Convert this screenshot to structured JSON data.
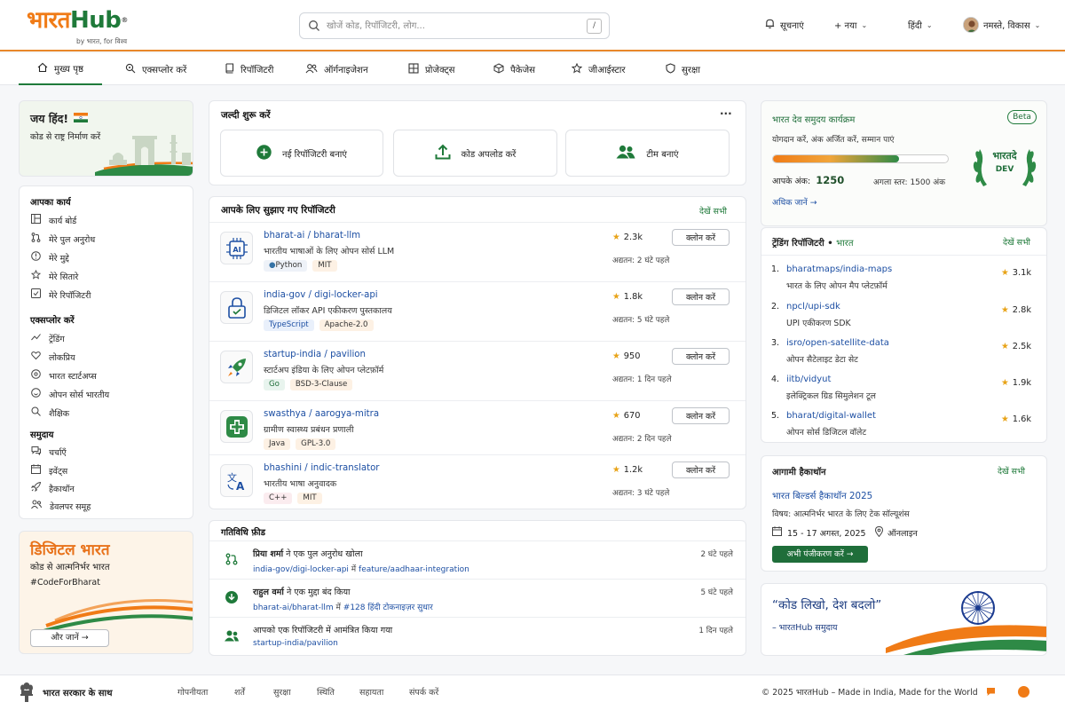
{
  "brand": {
    "name_hi": "भारत",
    "name_en": "Hub",
    "reg": "®",
    "tagline": "by भारत, for विश्व"
  },
  "colors": {
    "saffron": "#f07b16",
    "green": "#1f7a3a",
    "link": "#1d4fa3",
    "chakra_blue": "#1a3a8f"
  },
  "search": {
    "placeholder": "खोजें कोड, रिपॉजिटरी, लोग...",
    "shortcut": "/"
  },
  "header": {
    "notifications": "सूचनाएं",
    "new": "+ नया",
    "language": "हिंदी",
    "greeting": "नमस्ते, विकास"
  },
  "nav": {
    "items": [
      {
        "label": "मुख्य पृष्ठ",
        "icon": "home-icon",
        "active": true
      },
      {
        "label": "एक्सप्लोर करें",
        "icon": "explore-icon"
      },
      {
        "label": "रिपॉजिटरी",
        "icon": "repository-icon"
      },
      {
        "label": "ऑर्गनाइजेशन",
        "icon": "organization-icon"
      },
      {
        "label": "प्रोजेक्ट्स",
        "icon": "projects-icon"
      },
      {
        "label": "पैकेजेस",
        "icon": "package-icon"
      },
      {
        "label": "जीआईस्टार",
        "icon": "star-icon"
      },
      {
        "label": "सुरक्षा",
        "icon": "shield-icon"
      }
    ]
  },
  "welcome": {
    "title": "जय हिंद!",
    "subtitle": "कोड से राष्ट्र निर्माण करें"
  },
  "sidebar": {
    "work_title": "आपका कार्य",
    "work": [
      "कार्य बोर्ड",
      "मेरे पुल अनुरोध",
      "मेरे मुद्दे",
      "मेरे सितारे",
      "मेरे रिपॉजिटरी"
    ],
    "explore_title": "एक्सप्लोर करें",
    "explore": [
      "ट्रेंडिंग",
      "लोकप्रिय",
      "भारत स्टार्टअप्स",
      "ओपन सोर्स भारतीय",
      "शैक्षिक"
    ],
    "community_title": "समुदाय",
    "community": [
      "चर्चाएँ",
      "इवेंट्स",
      "हैकाथॉन",
      "डेवलपर समूह"
    ]
  },
  "digital": {
    "title": "डिजिटल भारत",
    "subtitle": "कोड से आत्मनिर्भर भारत",
    "hashtag": "#CodeForBharat",
    "button": "और जानें →"
  },
  "quickstart": {
    "title": "जल्दी शुरू करें",
    "menu": "···",
    "actions": [
      "नई रिपॉजिटरी बनाएं",
      "कोड अपलोड करें",
      "टीम बनाएं"
    ]
  },
  "suggested": {
    "title": "आपके लिए सुझाए गए रिपॉजिटरी",
    "see_all": "देखें सभी",
    "repos": [
      {
        "name": "bharat-ai / bharat-llm",
        "desc": "भारतीय भाषाओं के लिए ओपन सोर्स LLM",
        "lang": "Python",
        "license": "MIT",
        "stars": "2.3k",
        "updated": "अद्यतन: 2 घंटे पहले",
        "clone": "क्लोन करें"
      },
      {
        "name": "india-gov / digi-locker-api",
        "desc": "डिजिटल लॉकर API एकीकरण पुस्तकालय",
        "lang": "TypeScript",
        "license": "Apache-2.0",
        "stars": "1.8k",
        "updated": "अद्यतन: 5 घंटे पहले",
        "clone": "क्लोन करें"
      },
      {
        "name": "startup-india / pavilion",
        "desc": "स्टार्टअप इंडिया के लिए ओपन प्लेटफ़ॉर्म",
        "lang": "Go",
        "license": "BSD-3-Clause",
        "stars": "950",
        "updated": "अद्यतन: 1 दिन पहले",
        "clone": "क्लोन करें"
      },
      {
        "name": "swasthya / aarogya-mitra",
        "desc": "ग्रामीण स्वास्थ्य प्रबंधन प्रणाली",
        "lang": "Java",
        "license": "GPL-3.0",
        "stars": "670",
        "updated": "अद्यतन: 2 दिन पहले",
        "clone": "क्लोन करें"
      },
      {
        "name": "bhashini / indic-translator",
        "desc": "भारतीय भाषा अनुवादक",
        "lang": "C++",
        "license": "MIT",
        "stars": "1.2k",
        "updated": "अद्यतन: 3 घंटे पहले",
        "clone": "क्लोन करें"
      }
    ]
  },
  "activity": {
    "title": "गतिविधि फ़ीड",
    "items": [
      {
        "actor": "प्रिया शर्मा",
        "action": " ने एक पुल अनुरोध खोला",
        "repo": "india-gov/digi-locker-api",
        "mid": " में ",
        "ref": "feature/aadhaar-integration",
        "time": "2 घंटे पहले"
      },
      {
        "actor": "राहुल वर्मा",
        "action": " ने एक मुद्दा बंद किया",
        "repo": "bharat-ai/bharat-llm",
        "mid": " में ",
        "ref": "#128 हिंदी टोकनाइज़र सुधार",
        "time": "5 घंटे पहले"
      },
      {
        "actor": "",
        "action": "आपको एक रिपॉजिटरी में आमंत्रित किया गया",
        "repo": "startup-india/pavilion",
        "mid": "",
        "ref": "",
        "time": "1 दिन पहले"
      }
    ]
  },
  "devprogram": {
    "title": "भारत देव समुदय कार्यक्रम",
    "badge": "Beta",
    "subtitle": "योगदान करें, अंक अर्जित करें, सम्मान पाएं",
    "progress": 0.72,
    "points_label": "आपके अंक:",
    "points": "1250",
    "next_level": "अगला स्तर: 1500 अंक",
    "more": "अधिक जानें →",
    "emblem_top": "भारतदे",
    "emblem_bottom": "DEV"
  },
  "trending": {
    "title": "ट्रेंडिंग रिपॉजिटरी • ",
    "title_accent": "भारत",
    "see_all": "देखें सभी",
    "items": [
      {
        "rank": "1.",
        "name": "bharatmaps/india-maps",
        "desc": "भारत के लिए ओपन मैप प्लेटफ़ॉर्म",
        "stars": "3.1k"
      },
      {
        "rank": "2.",
        "name": "npcl/upi-sdk",
        "desc": "UPI एकीकरण SDK",
        "stars": "2.8k"
      },
      {
        "rank": "3.",
        "name": "isro/open-satellite-data",
        "desc": "ओपन सैटेलाइट डेटा सेट",
        "stars": "2.5k"
      },
      {
        "rank": "4.",
        "name": "iitb/vidyut",
        "desc": "इलेक्ट्रिकल ग्रिड सिमुलेशन टूल",
        "stars": "1.9k"
      },
      {
        "rank": "5.",
        "name": "bharat/digital-wallet",
        "desc": "ओपन सोर्स डिजिटल वॉलेट",
        "stars": "1.6k"
      }
    ]
  },
  "hackathon": {
    "title": "आगामी हैकाथॉन",
    "see_all": "देखें सभी",
    "name": "भारत बिल्डर्स हैकाथॉन 2025",
    "topic": "विषय: आत्मनिर्भर भारत के लिए टेक सॉल्यूशंस",
    "dates": "15 - 17 अगस्त, 2025",
    "mode": "ऑनलाइन",
    "register": "अभी पंजीकरण करें →"
  },
  "quote": {
    "text": "“कोड लिखो, देश बदलो”",
    "author": "– भारतHub समुदाय"
  },
  "footer": {
    "gov": "भारत सरकार के साथ",
    "links": [
      "गोपनीयता",
      "शर्तें",
      "सुरक्षा",
      "स्थिति",
      "सहायता",
      "संपर्क करें"
    ],
    "copyright": "© 2025 भारतHub – Made in India, Made for the World"
  }
}
